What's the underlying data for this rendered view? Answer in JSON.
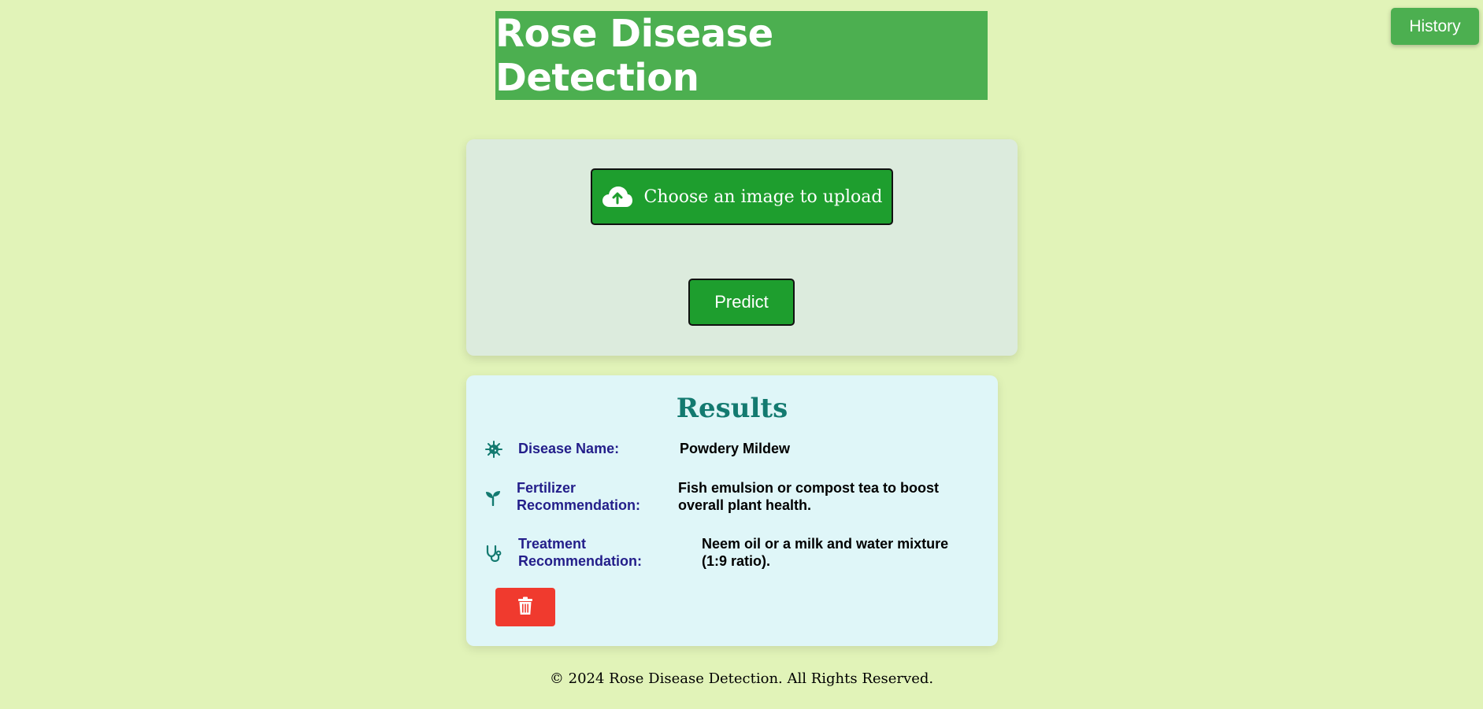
{
  "header": {
    "history_label": "History",
    "title": "Rose Disease Detection"
  },
  "upload": {
    "choose_label": "Choose an image to upload",
    "predict_label": "Predict"
  },
  "results": {
    "title": "Results",
    "rows": [
      {
        "icon": "virus-icon",
        "label_line1": "Disease Name:",
        "label_line2": "",
        "value_line1": "Powdery Mildew",
        "value_line2": ""
      },
      {
        "icon": "seedling-icon",
        "label_line1": "Fertilizer",
        "label_line2": "Recommendation:",
        "value_line1": "Fish emulsion or compost tea to boost",
        "value_line2": "overall plant health."
      },
      {
        "icon": "stethoscope-icon",
        "label_line1": "Treatment",
        "label_line2": "Recommendation:",
        "value_line1": "Neem oil or a milk and water mixture",
        "value_line2": "(1:9 ratio)."
      }
    ],
    "delete_icon": "trash-icon"
  },
  "footer": {
    "text": "© 2024 Rose Disease Detection. All Rights Reserved."
  },
  "colors": {
    "background": "#e1f3b8",
    "brand_green": "#4caf50",
    "button_green": "#1e9e2e",
    "results_title": "#137a70",
    "label_color": "#231e8a",
    "delete_red": "#f03a2e"
  }
}
